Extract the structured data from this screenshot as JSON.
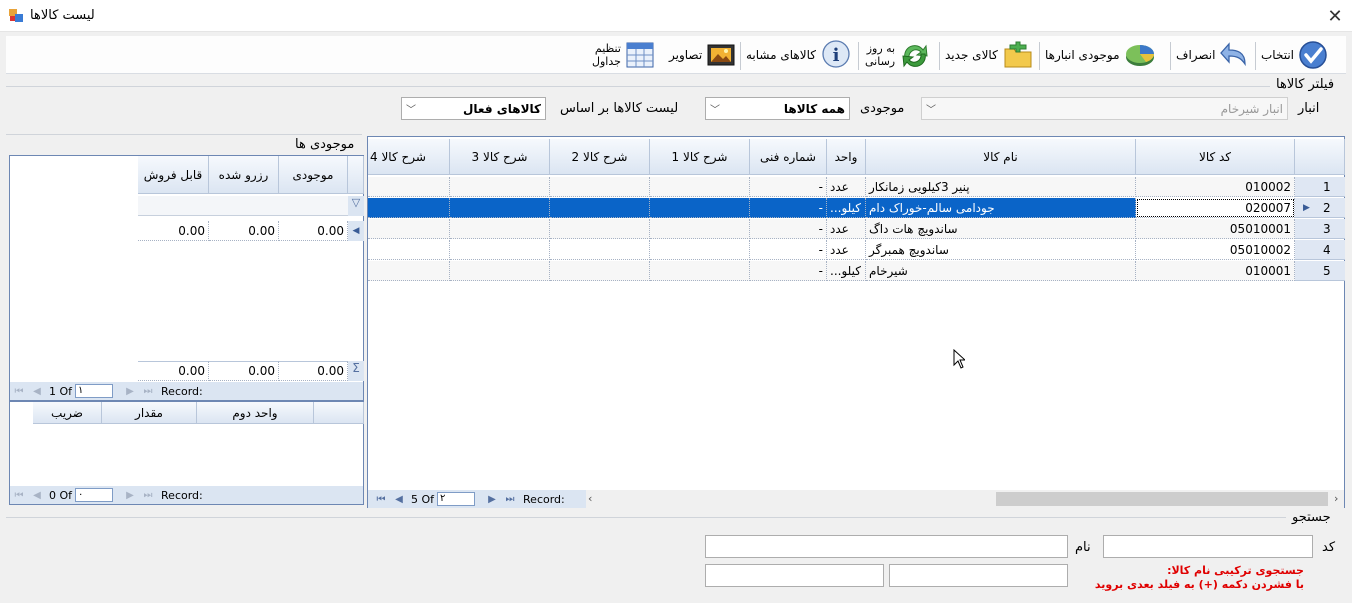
{
  "window": {
    "title": "لیست کالاها",
    "close": "✕"
  },
  "toolbar": {
    "select": "انتخاب",
    "cancel": "انصراف",
    "warehouse_stock": "موجودی انبارها",
    "new_item": "کالای جدید",
    "update_l1": "به روز",
    "update_l2": "رسانی",
    "similar": "کالاهای مشابه",
    "images": "تصاویر",
    "table_l1": "تنظیم",
    "table_l2": "جداول"
  },
  "filter": {
    "group_label": "فیلتر کالاها",
    "warehouse_label": "انبار",
    "warehouse_value": "انبار شیرخام",
    "stock_label": "موجودی",
    "stock_value": "همه کالاها",
    "list_label": "لیست کالاها بر اساس",
    "list_value": "کالاهای فعال"
  },
  "main_grid": {
    "columns": [
      "کد کالا",
      "نام کالا",
      "واحد",
      "شماره فنی",
      "شرح کالا 1",
      "شرح کالا 2",
      "شرح کالا 3",
      "شرح کالا 4"
    ],
    "rows": [
      {
        "n": "1",
        "code": "010002",
        "name": "پنیر 3کیلویی زمانکار",
        "unit": "عدد",
        "tech": "-"
      },
      {
        "n": "2",
        "code": "020007",
        "name": "جودامی سالم-خوراک دام",
        "unit": "کیلو...",
        "tech": "-"
      },
      {
        "n": "3",
        "code": "05010001",
        "name": "ساندویچ هات داگ",
        "unit": "عدد",
        "tech": "-"
      },
      {
        "n": "4",
        "code": "05010002",
        "name": "ساندویچ همبرگر",
        "unit": "عدد",
        "tech": "-"
      },
      {
        "n": "5",
        "code": "010001",
        "name": "شیرخام",
        "unit": "کیلو...",
        "tech": "-"
      }
    ],
    "selected_row": 2,
    "nav": {
      "record": "Record:",
      "of": "5 Of",
      "page": "۲"
    }
  },
  "stock_panel": {
    "title": "موجودی ها",
    "columns": [
      "موجودی",
      "رزرو شده",
      "قابل فروش"
    ],
    "row": [
      "0.00",
      "0.00",
      "0.00"
    ],
    "totals": [
      "0.00",
      "0.00",
      "0.00"
    ],
    "nav": {
      "record": "Record:",
      "of": "1 Of",
      "page": "۱"
    }
  },
  "unit_panel": {
    "columns": [
      "واحد دوم",
      "مقدار",
      "ضریب"
    ],
    "nav": {
      "record": "Record:",
      "of": "0 Of",
      "page": "۰"
    }
  },
  "search": {
    "group_label": "جستجو",
    "code_label": "کد",
    "name_label": "نام",
    "hint_l1": "جستجوی ترکیبی نام کالا:",
    "hint_l2": "با فشردن دکمه (+) به فیلد بعدی بروید"
  },
  "colors": {
    "selection": "#0a64c8",
    "hint": "#e00000",
    "header": "#dbe5f2"
  }
}
